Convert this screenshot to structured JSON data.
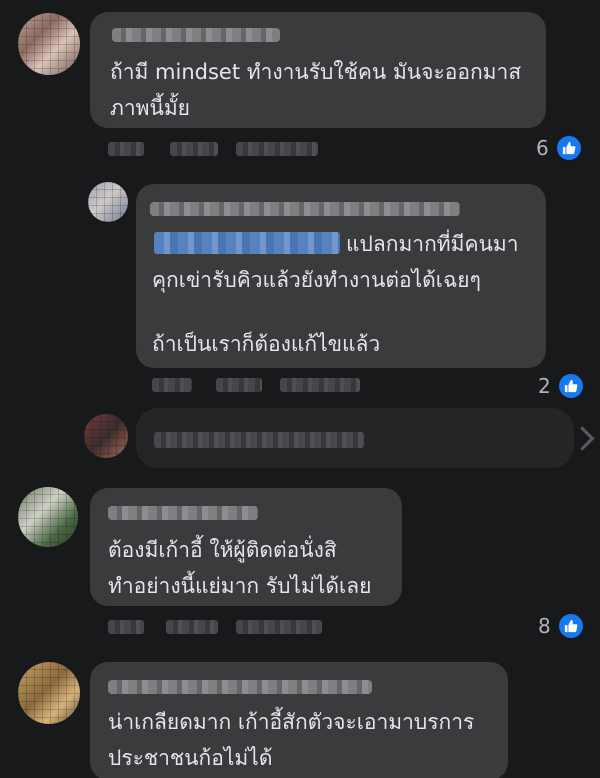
{
  "comments": [
    {
      "text_lines": [
        "ถ้ามี mindset ทำงานรับใช้คน มันจะออกมาส",
        "ภาพนี้มั้ย"
      ],
      "reaction_count": "6",
      "reaction_icon": "like-icon"
    },
    {
      "text_lines": [
        "แปลกมากที่มีคนมา",
        "คุกเข่ารับคิวแล้วยังทำงานต่อได้เฉยๆ",
        "ถ้าเป็นเราก็ต้องแก้ไขแล้ว"
      ],
      "reaction_count": "2",
      "reaction_icon": "like-icon"
    },
    {
      "text_lines": [
        "ต้องมีเก้าอี้ ให้ผู้ติดต่อนั่งสิ",
        "ทำอย่างนี้แย่มาก รับไม่ได้เลย"
      ],
      "reaction_count": "8",
      "reaction_icon": "like-icon"
    },
    {
      "text_lines": [
        "น่าเกลียดมาก เก้าอี้สักตัวจะเอามาบรการ",
        "ประชาชนก้อไม่ได้"
      ]
    }
  ],
  "colors": {
    "background": "#18191a",
    "bubble": "#3a3b3c",
    "reply_input": "#242526",
    "like_blue": "#1877f2",
    "text": "#e4e6eb",
    "muted": "#b0b3b8"
  }
}
